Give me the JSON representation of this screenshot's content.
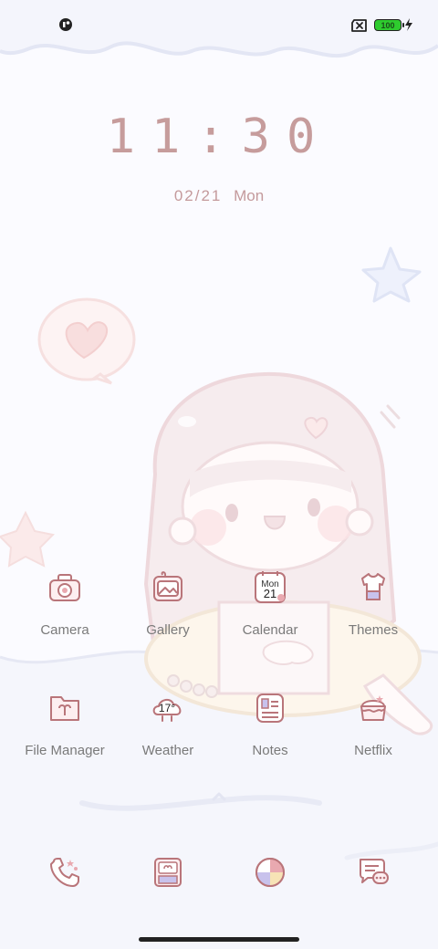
{
  "status_bar": {
    "left_icon": "notification-dot-icon",
    "sim_icon": "no-sim-icon",
    "battery_level": "100",
    "charging_icon": "bolt-icon"
  },
  "clock": {
    "time": "11:30"
  },
  "date": {
    "value": "02/21",
    "weekday": "Mon"
  },
  "apps": [
    {
      "label": "Camera",
      "icon": "camera-icon"
    },
    {
      "label": "Gallery",
      "icon": "gallery-icon"
    },
    {
      "label": "Calendar",
      "icon": "calendar-icon",
      "month": "Mon",
      "day": "21"
    },
    {
      "label": "Themes",
      "icon": "themes-icon"
    },
    {
      "label": "File Manager",
      "icon": "folder-icon"
    },
    {
      "label": "Weather",
      "icon": "weather-icon",
      "temp": "17°"
    },
    {
      "label": "Notes",
      "icon": "notes-icon"
    },
    {
      "label": "Netflix",
      "icon": "cake-icon"
    }
  ],
  "dock": [
    {
      "icon": "phone-icon"
    },
    {
      "icon": "contacts-book-icon"
    },
    {
      "icon": "browser-icon"
    },
    {
      "icon": "messages-icon"
    }
  ],
  "colors": {
    "accent": "#c69c9c",
    "icon_stroke": "#b9757a",
    "label": "#7a7a7a"
  }
}
